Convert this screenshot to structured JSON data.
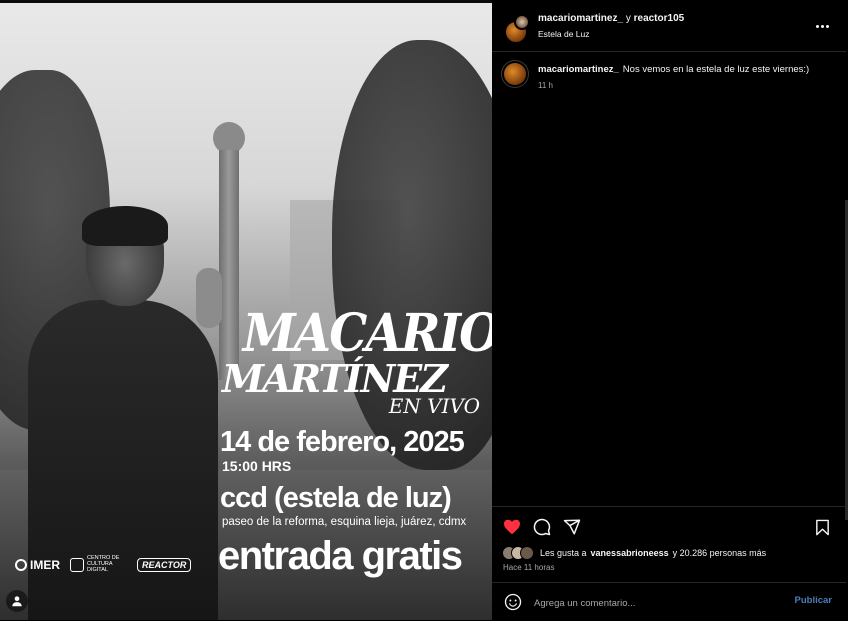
{
  "poster": {
    "title_line1": "MACARIO",
    "title_line2": "MARTÍNEZ",
    "subtitle": "EN VIVO",
    "date": "14 de febrero, 2025",
    "time": "15:00 HRS",
    "venue": "ccd (estela de luz)",
    "address": "paseo de la reforma, esquina lieja, juárez, cdmx",
    "entry": "entrada gratis",
    "logos": {
      "imer": "IMER",
      "ccd": "CENTRO DE CULTURA DIGITAL",
      "reactor": "REACTOR"
    }
  },
  "header": {
    "user_primary": "macariomartinez_",
    "joiner": "y",
    "user_secondary": "reactor105",
    "location": "Estela de Luz",
    "more_icon": "more-horizontal-icon"
  },
  "caption": {
    "username": "macariomartinez_",
    "text": "Nos vemos en la estela de luz este viernes:)",
    "time": "11 h"
  },
  "actions": {
    "like_icon": "heart-filled-icon",
    "comment_icon": "comment-icon",
    "share_icon": "share-icon",
    "save_icon": "bookmark-icon",
    "like_color": "#ff3040"
  },
  "likes": {
    "prefix": "Les gusta a",
    "user": "vanessabrioneess",
    "suffix": "y 20.286 personas más",
    "time": "Hace 11 horas"
  },
  "comment": {
    "placeholder": "Agrega un comentario...",
    "post_label": "Publicar"
  }
}
